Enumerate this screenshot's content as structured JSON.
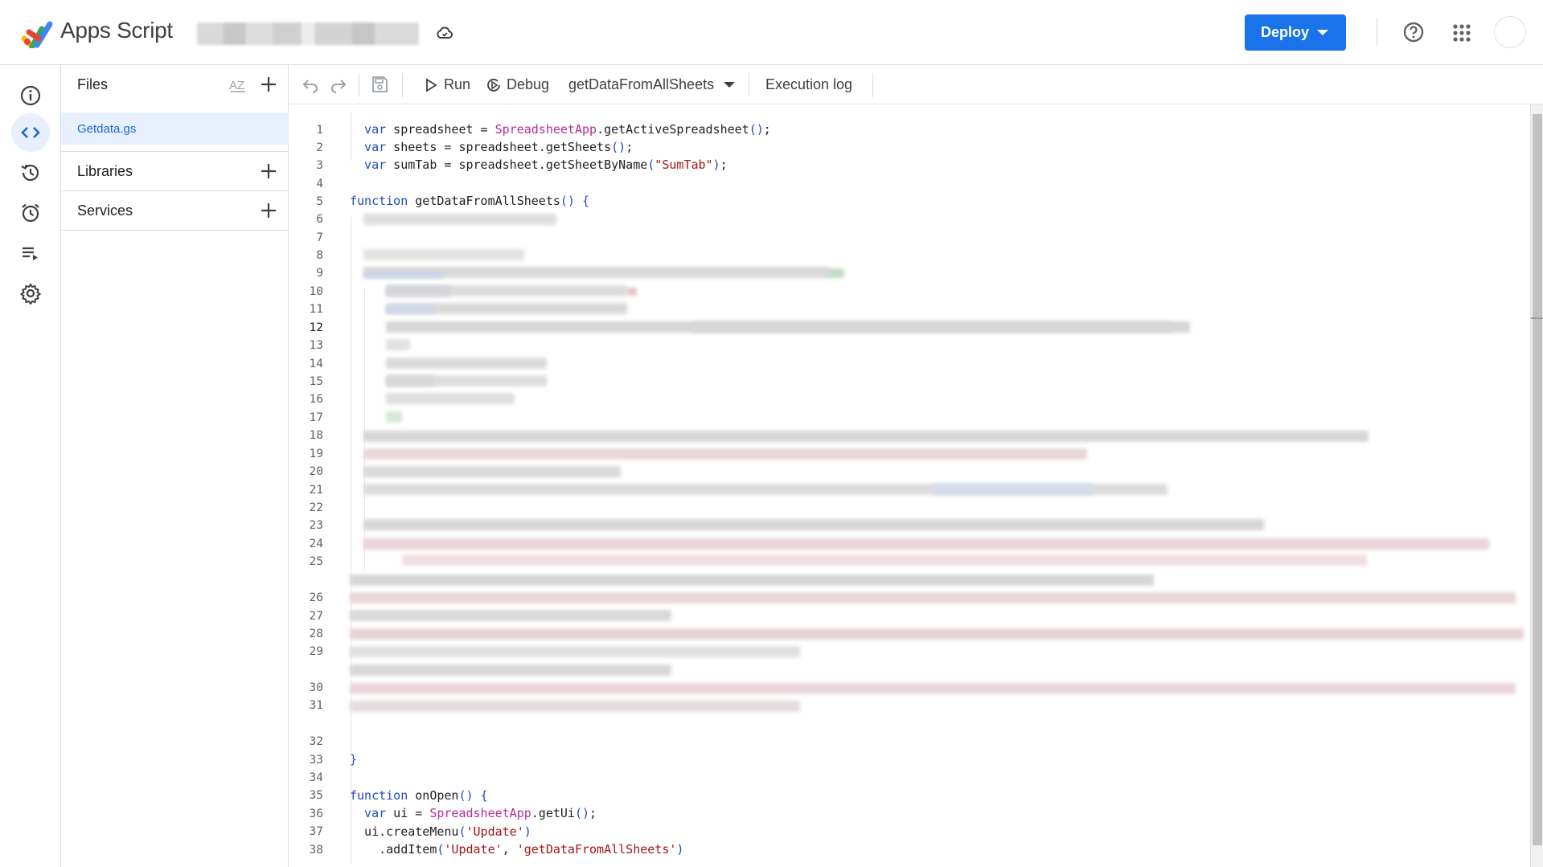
{
  "header": {
    "app_title": "Apps Script",
    "deploy_label": "Deploy"
  },
  "rail": {
    "items": [
      "overview-icon",
      "editor-icon",
      "triggers-history-icon",
      "triggers-icon",
      "executions-icon",
      "settings-icon"
    ],
    "active": "editor-icon"
  },
  "files_panel": {
    "files_label": "Files",
    "files": [
      "Getdata.gs"
    ],
    "libraries_label": "Libraries",
    "services_label": "Services"
  },
  "toolbar": {
    "run_label": "Run",
    "debug_label": "Debug",
    "function_selected": "getDataFromAllSheets",
    "execution_log_label": "Execution log"
  },
  "editor": {
    "line_numbers": [
      "1",
      "2",
      "3",
      "4",
      "5",
      "6",
      "7",
      "8",
      "9",
      "10",
      "11",
      "12",
      "13",
      "14",
      "15",
      "16",
      "17",
      "18",
      "19",
      "20",
      "21",
      "22",
      "23",
      "24",
      "25",
      "26",
      "27",
      "28",
      "29",
      "30",
      "31",
      "32",
      "33",
      "34",
      "35",
      "36",
      "37",
      "38"
    ],
    "current_line": "12",
    "visible_code": {
      "l1": "  var spreadsheet = SpreadsheetApp.getActiveSpreadsheet();",
      "l2": "  var sheets = spreadsheet.getSheets();",
      "l3": "  var sumTab = spreadsheet.getSheetByName(\"SumTab\");",
      "l5": "function getDataFromAllSheets() {",
      "l33": "}",
      "l35": "function onOpen() {",
      "l36": "  var ui = SpreadsheetApp.getUi();",
      "l37": "  ui.createMenu('Update')",
      "l38": "    .addItem('Update', 'getDataFromAllSheets')"
    }
  },
  "colors": {
    "accent": "#1a73e8",
    "keyword": "#1f4bc2",
    "class": "#b62b9f",
    "string": "#a31515",
    "active_file_bg": "#e8f0fe"
  }
}
